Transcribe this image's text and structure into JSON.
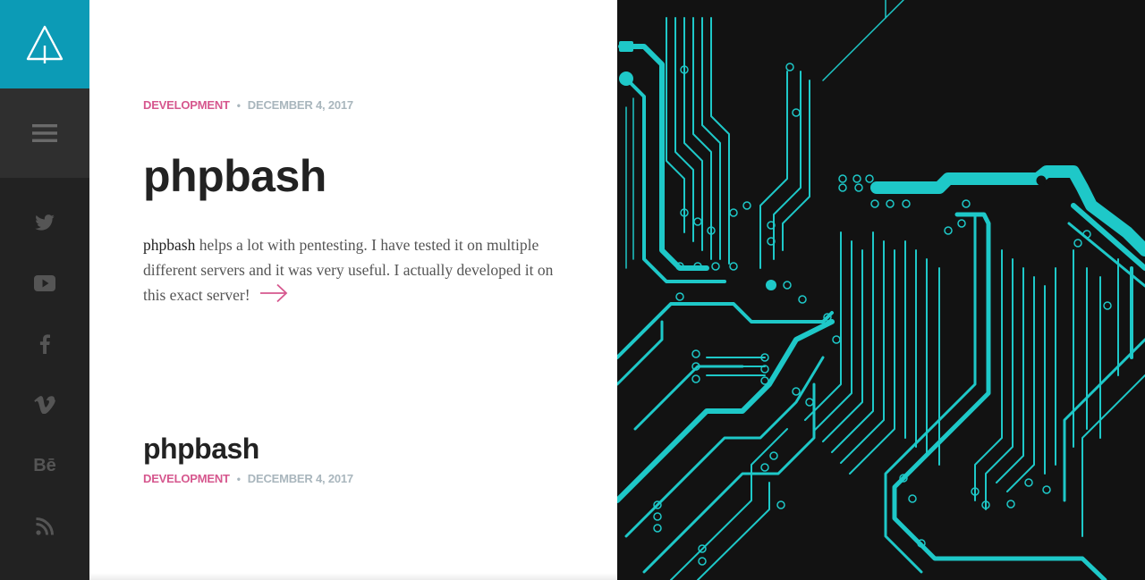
{
  "sidebar": {
    "logo_icon": "tree-arrow-icon",
    "menu_icon": "hamburger-icon",
    "social": [
      "twitter-icon",
      "youtube-icon",
      "facebook-icon",
      "vimeo-icon",
      "behance-icon",
      "rss-icon"
    ],
    "behance_text": "Bē"
  },
  "posts": [
    {
      "category": "DEVELOPMENT",
      "separator": "•",
      "date": "DECEMBER 4, 2017",
      "title": "phpbash",
      "excerpt_lead": "phpbash",
      "excerpt_rest": " helps a lot with pentesting. I have tested it on multiple different servers and it was very useful. I actually developed it on this exact server!"
    },
    {
      "title": "phpbash",
      "category": "DEVELOPMENT",
      "separator": "•",
      "date": "DECEMBER 4, 2017"
    }
  ],
  "colors": {
    "accent": "#0c9bb6",
    "category": "#d6578e",
    "meta": "#a9b6bd",
    "circuit": "#1ec8c8"
  }
}
